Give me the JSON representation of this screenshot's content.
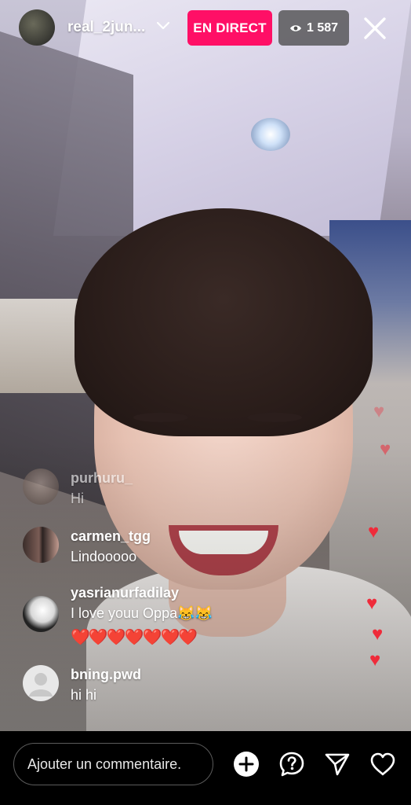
{
  "header": {
    "username": "real_2jun...",
    "live_label": "EN DIRECT",
    "viewer_count": "1 587",
    "icons": [
      "chevron-down-icon",
      "eye-icon",
      "close-icon"
    ]
  },
  "comments": [
    {
      "username": "purhuru_",
      "text": "Hi",
      "faded": true
    },
    {
      "username": "carmen_tgg",
      "text": "Lindooooo"
    },
    {
      "username": "yasrianurfadilay",
      "text": "I love youu Oppa😹😹",
      "extra": "❤️❤️❤️❤️❤️❤️❤️"
    },
    {
      "username": "bning.pwd",
      "text": "hi hi"
    }
  ],
  "floating_hearts_count": 7,
  "bottom_bar": {
    "comment_placeholder": "Ajouter un commentaire.",
    "icons": [
      "add-icon",
      "question-icon",
      "send-icon",
      "heart-icon"
    ]
  },
  "colors": {
    "live_badge": "#ff0f66",
    "heart": "#ef2b3a"
  }
}
